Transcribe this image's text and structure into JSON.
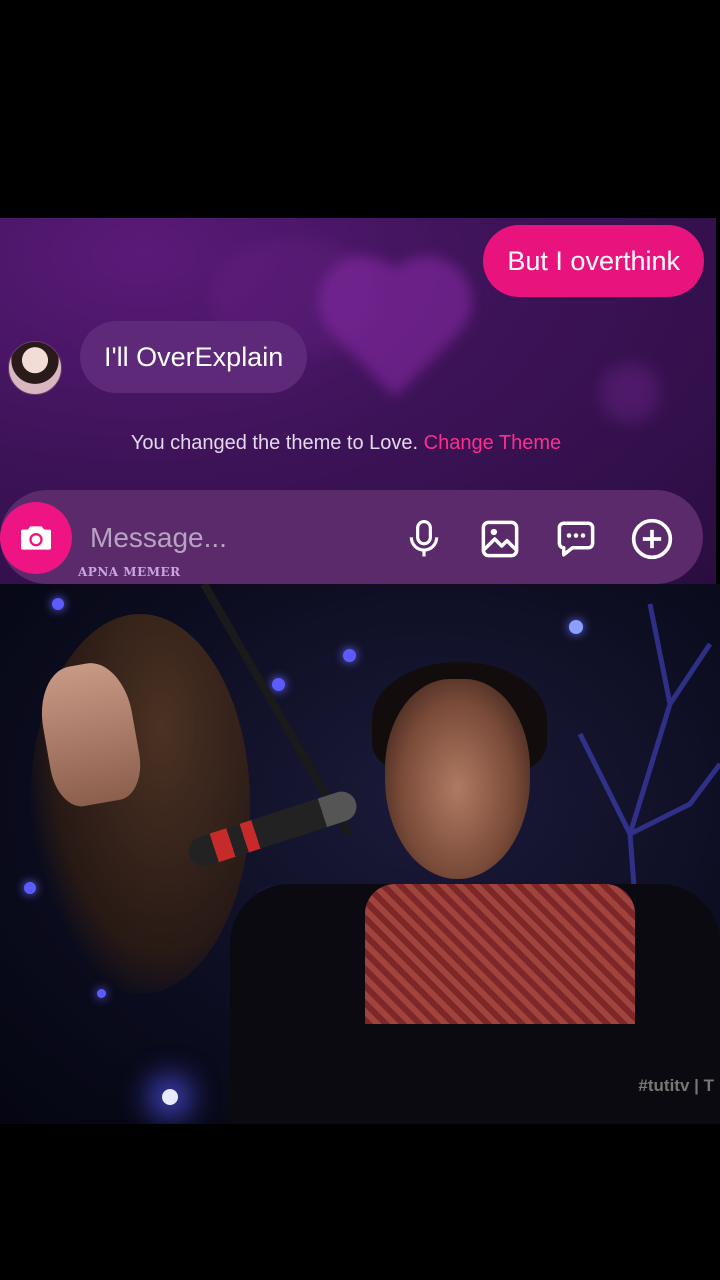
{
  "chat": {
    "outgoing_message": "But I overthink",
    "incoming_message": "I'll OverExplain",
    "theme_notice": {
      "text": "You changed the theme to Love.",
      "link_label": "Change Theme"
    },
    "composer": {
      "placeholder": "Message...",
      "icons": [
        "camera-icon",
        "microphone-icon",
        "image-icon",
        "sticker-icon",
        "plus-icon"
      ]
    }
  },
  "watermarks": {
    "meme_page": "APNA MEMER",
    "channel": "#tutitv | T"
  },
  "colors": {
    "accent_pink": "#e8137d",
    "theme_purple": "#3d1358",
    "incoming_bubble": "#5d2978"
  }
}
